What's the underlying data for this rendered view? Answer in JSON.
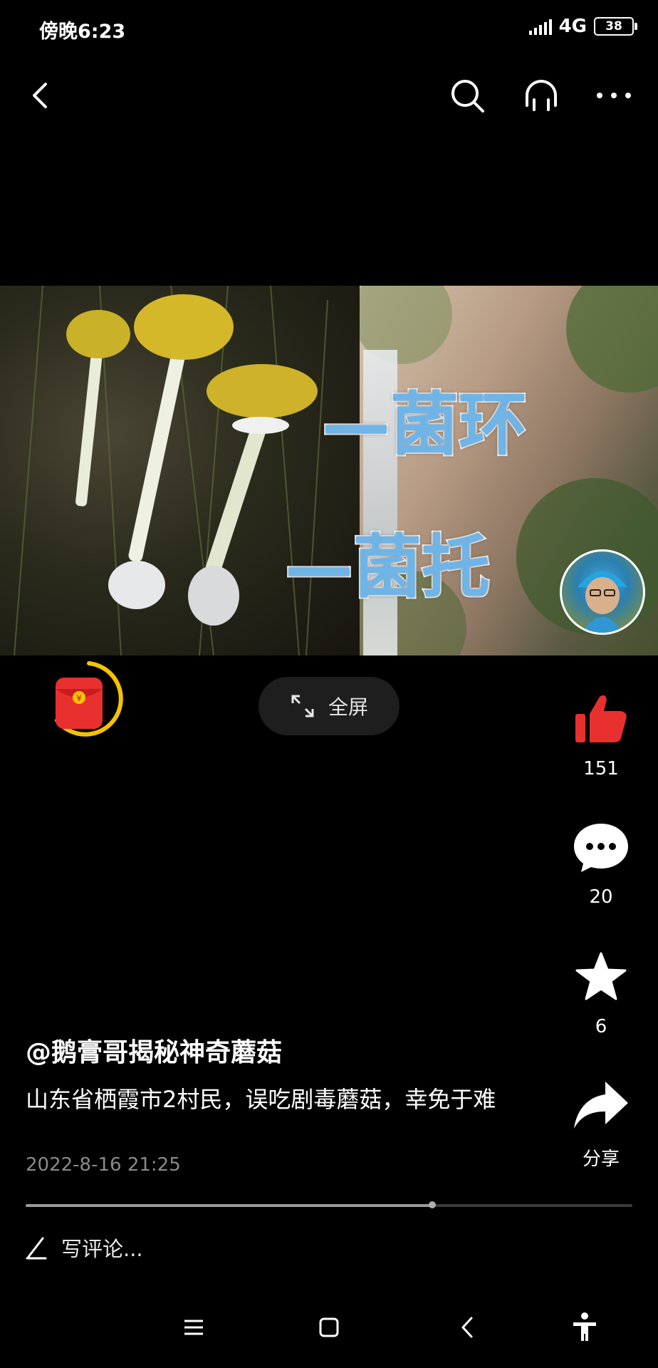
{
  "status_bar": {
    "time": "傍晚6:23",
    "network": "4G",
    "battery": "38"
  },
  "nav": {
    "back_icon": "chevron-left-icon",
    "search_icon": "search-icon",
    "audio_icon": "headphones-icon",
    "more_icon": "more-icon"
  },
  "video": {
    "overlay_line1": "—菌环",
    "overlay_line2": "—菌托"
  },
  "fullscreen": {
    "label": "全屏"
  },
  "actions": {
    "like_count": "151",
    "comment_count": "20",
    "favorite_count": "6",
    "share_label": "分享"
  },
  "post": {
    "author": "@鹅膏哥揭秘神奇蘑菇",
    "description": "山东省栖霞市2村民，误吃剧毒蘑菇，幸免于难",
    "date": "2022-8-16 21:25"
  },
  "progress": {
    "fraction": 0.67
  },
  "comment": {
    "placeholder": "写评论..."
  },
  "colors": {
    "like": "#e8302f",
    "accent_ring": "#f5c400",
    "overlay_text": "#6fb4e6"
  }
}
